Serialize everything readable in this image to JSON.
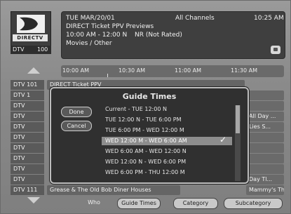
{
  "header": {
    "logo_text": "DIRECTV",
    "date_line": "TUE MAR/20/01",
    "channel_filter": "All Channels",
    "clock": "10:25 AM",
    "program_title": "DIRECT Ticket PPV Previews",
    "time_range": "10:00 AM - 12:00 N",
    "rating": "NR (Not Rated)",
    "category": "Movies / Other",
    "channel_name": "DTV",
    "channel_number": "100"
  },
  "timeline": {
    "times": [
      "10:00 AM",
      "10:30 AM",
      "11:00 AM",
      "11:30 AM"
    ]
  },
  "grid": {
    "rows": [
      {
        "channel": "DTV",
        "number": "101",
        "program": "DIRECT Ticket PPV",
        "right": ""
      },
      {
        "channel": "DTV",
        "number": "1",
        "program": "",
        "right": ""
      },
      {
        "channel": "DTV",
        "number": "",
        "program": "",
        "right": ""
      },
      {
        "channel": "DTV",
        "number": "",
        "program": "",
        "right": "All Day ..."
      },
      {
        "channel": "DTV",
        "number": "",
        "program": "",
        "right": "Lies S..."
      },
      {
        "channel": "DTV",
        "number": "",
        "program": "",
        "right": ""
      },
      {
        "channel": "DTV",
        "number": "",
        "program": "",
        "right": ""
      },
      {
        "channel": "DTV",
        "number": "",
        "program": "",
        "right": ""
      },
      {
        "channel": "DTV",
        "number": "",
        "program": "",
        "right": ""
      },
      {
        "channel": "DTV",
        "number": "",
        "program": "",
        "right": "Day Tl..."
      },
      {
        "channel": "DTV",
        "number": "111",
        "program": "Grease & The Old Bob Diner Houses",
        "right": "Mammy's Th..."
      }
    ]
  },
  "bottom_bar": {
    "who": "Who",
    "guide_times": "Guide Times",
    "category": "Category",
    "subcategory": "Subcategory"
  },
  "modal": {
    "title": "Guide Times",
    "done": "Done",
    "cancel": "Cancel",
    "options": [
      "Current - TUE 12:00 N",
      "TUE 12:00 N - TUE 6:00 PM",
      "TUE 6:00 PM - WED 12:00 M",
      "WED 12:00 M - WED 6:00 AM",
      "WED 6:00 AM - WED 12:00 N",
      "WED 12:00 N - WED 6:00 PM",
      "WED 6:00 PM - THU 12:00 M"
    ],
    "selected_index": 3,
    "check_symbol": "✓"
  }
}
